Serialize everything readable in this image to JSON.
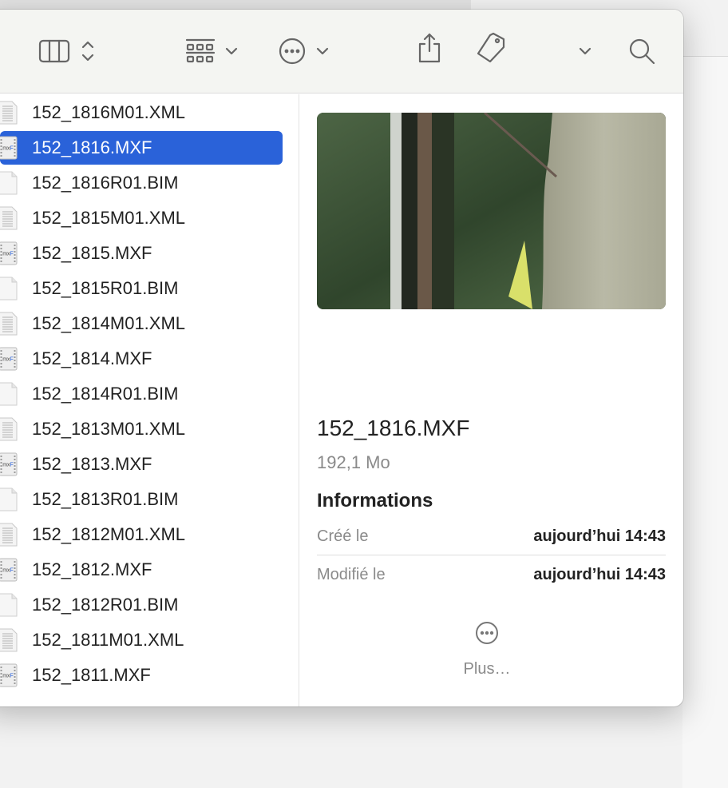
{
  "toolbar": {
    "items": [
      "view-columns",
      "sort",
      "group",
      "more-actions",
      "share",
      "tag",
      "overflow",
      "search"
    ]
  },
  "files": [
    {
      "name": "152_1816M01.XML",
      "type": "xml"
    },
    {
      "name": "152_1816.MXF",
      "type": "mxf",
      "selected": true
    },
    {
      "name": "152_1816R01.BIM",
      "type": "bim"
    },
    {
      "name": "152_1815M01.XML",
      "type": "xml"
    },
    {
      "name": "152_1815.MXF",
      "type": "mxf"
    },
    {
      "name": "152_1815R01.BIM",
      "type": "bim"
    },
    {
      "name": "152_1814M01.XML",
      "type": "xml"
    },
    {
      "name": "152_1814.MXF",
      "type": "mxf"
    },
    {
      "name": "152_1814R01.BIM",
      "type": "bim"
    },
    {
      "name": "152_1813M01.XML",
      "type": "xml"
    },
    {
      "name": "152_1813.MXF",
      "type": "mxf"
    },
    {
      "name": "152_1813R01.BIM",
      "type": "bim"
    },
    {
      "name": "152_1812M01.XML",
      "type": "xml"
    },
    {
      "name": "152_1812.MXF",
      "type": "mxf"
    },
    {
      "name": "152_1812R01.BIM",
      "type": "bim"
    },
    {
      "name": "152_1811M01.XML",
      "type": "xml"
    },
    {
      "name": "152_1811.MXF",
      "type": "mxf"
    }
  ],
  "mxf_icon_label": "MXF",
  "details": {
    "name": "152_1816.MXF",
    "size": "192,1 Mo",
    "info_heading": "Informations",
    "created_label": "Créé le",
    "created_value": "aujourd’hui 14:43",
    "modified_label": "Modifié le",
    "modified_value": "aujourd’hui 14:43",
    "more_label": "Plus…"
  },
  "colors": {
    "selection": "#2a62d9",
    "toolbar": "#f4f5f2"
  }
}
